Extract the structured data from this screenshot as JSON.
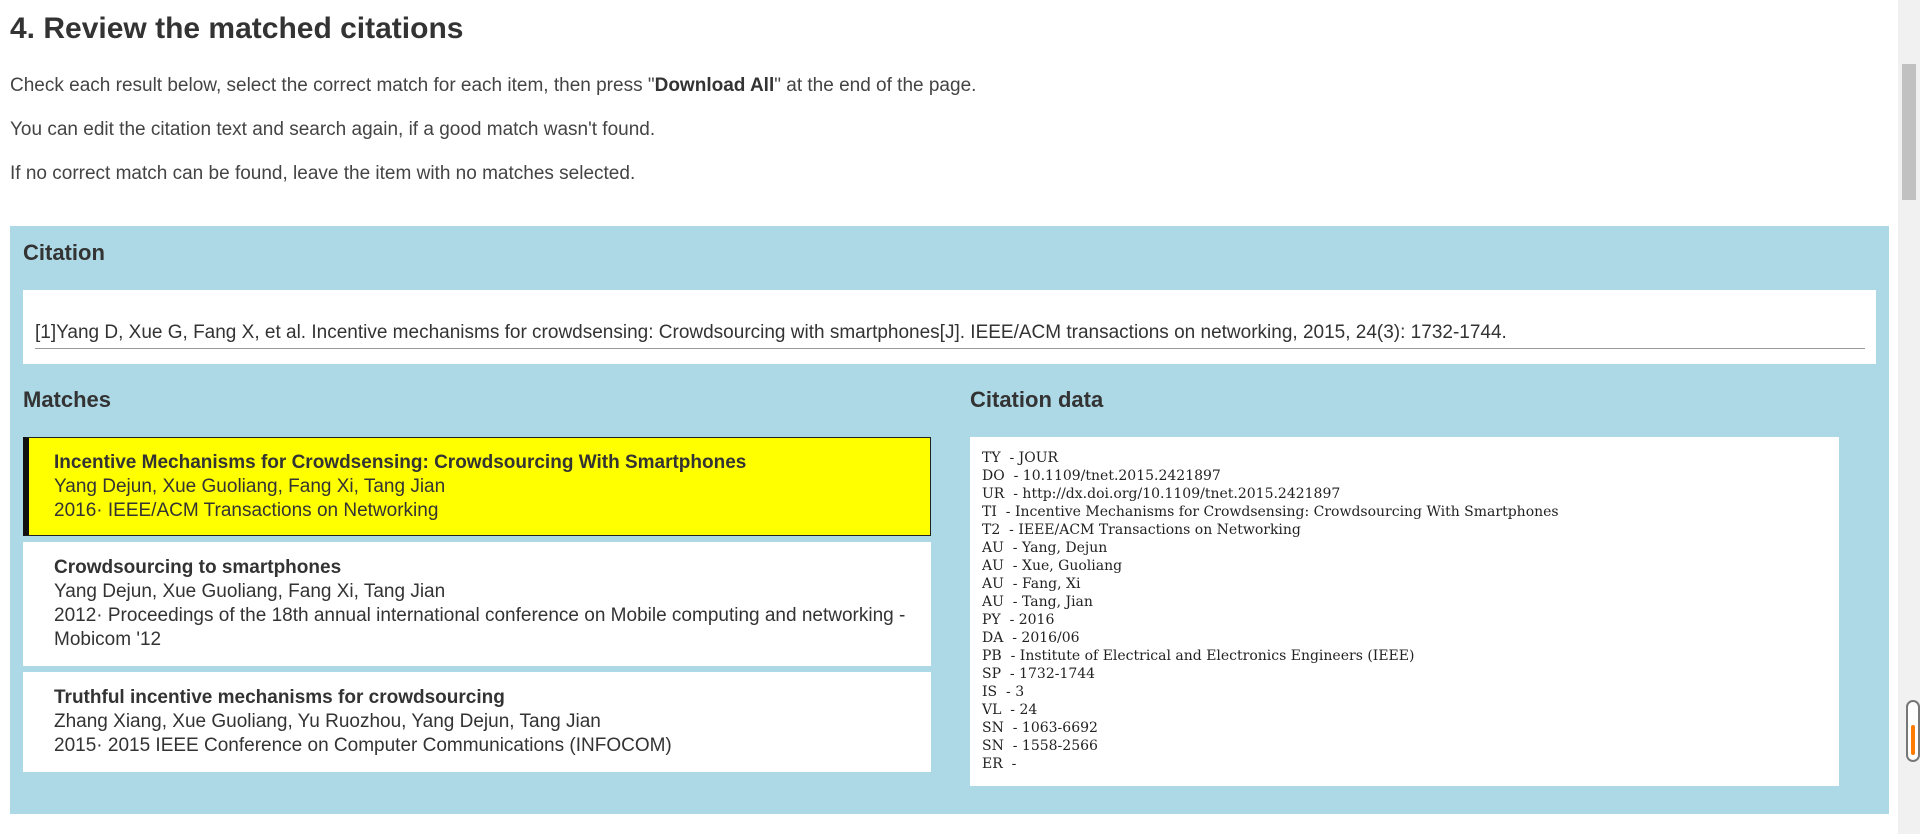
{
  "section": {
    "title": "4. Review the matched citations",
    "instructions": {
      "line1_before": "Check each result below, select the correct match for each item, then press \"",
      "line1_bold": "Download All",
      "line1_after": "\" at the end of the page.",
      "line2": "You can edit the citation text and search again, if a good match wasn't found.",
      "line3": "If no correct match can be found, leave the item with no matches selected."
    }
  },
  "citation": {
    "heading": "Citation",
    "text": "[1]Yang D, Xue G, Fang X, et al. Incentive mechanisms for crowdsensing: Crowdsourcing with smartphones[J]. IEEE/ACM transactions on networking, 2015, 24(3): 1732-1744."
  },
  "matches": {
    "heading": "Matches",
    "items": [
      {
        "title": "Incentive Mechanisms for Crowdsensing: Crowdsourcing With Smartphones",
        "authors": "Yang Dejun, Xue Guoliang, Fang Xi, Tang Jian",
        "venue": "2016· IEEE/ACM Transactions on Networking"
      },
      {
        "title": "Crowdsourcing to smartphones",
        "authors": "Yang Dejun, Xue Guoliang, Fang Xi, Tang Jian",
        "venue": "2012· Proceedings of the 18th annual international conference on Mobile computing and networking - Mobicom '12"
      },
      {
        "title": "Truthful incentive mechanisms for crowdsourcing",
        "authors": "Zhang Xiang, Xue Guoliang, Yu Ruozhou, Yang Dejun, Tang Jian",
        "venue": "2015· 2015 IEEE Conference on Computer Communications (INFOCOM)"
      }
    ]
  },
  "citation_data": {
    "heading": "Citation data",
    "lines": [
      "TY  - JOUR",
      "DO  - 10.1109/tnet.2015.2421897",
      "UR  - http://dx.doi.org/10.1109/tnet.2015.2421897",
      "TI  - Incentive Mechanisms for Crowdsensing: Crowdsourcing With Smartphones",
      "T2  - IEEE/ACM Transactions on Networking",
      "AU  - Yang, Dejun",
      "AU  - Xue, Guoliang",
      "AU  - Fang, Xi",
      "AU  - Tang, Jian",
      "PY  - 2016",
      "DA  - 2016/06",
      "PB  - Institute of Electrical and Electronics Engineers (IEEE)",
      "SP  - 1732-1744",
      "IS  - 3",
      "VL  - 24",
      "SN  - 1063-6692",
      "SN  - 1558-2566",
      "ER  -"
    ]
  },
  "colors": {
    "panel_bg": "#add8e6",
    "selected_bg": "#ffff00",
    "scroll_accent": "#ff7a00"
  }
}
